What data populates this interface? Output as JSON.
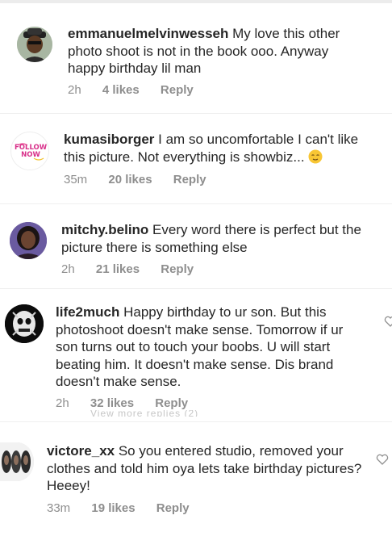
{
  "comments": [
    {
      "username": "emmanuelmelvinwesseh",
      "text": " My love this other photo shoot is not in the book ooo. Anyway happy birthday lil man",
      "time": "2h",
      "likes": "4 likes",
      "reply": "Reply",
      "avatar_icon": "avatar-man-hat"
    },
    {
      "username": "kumasiborger",
      "text": " I am so uncomfortable I can't like this picture. Not everything is showbiz... ",
      "emoji": "relieved-face-emoji",
      "time": "35m",
      "likes": "20 likes",
      "reply": "Reply",
      "avatar_text": "FOLLOW NOW"
    },
    {
      "username": "mitchy.belino",
      "text": " Every word there is perfect but the picture there is something else",
      "time": "2h",
      "likes": "21 likes",
      "reply": "Reply",
      "avatar_icon": "avatar-woman"
    },
    {
      "username": "life2much",
      "text": " Happy birthday to ur son. But this photoshoot doesn't make sense. Tomorrow if ur son turns out to touch your boobs. U will start beating him. It doesn't make sense. Dis brand doesn't make sense.",
      "time": "2h",
      "likes": "32 likes",
      "reply": "Reply",
      "avatar_icon": "avatar-skull-art"
    },
    {
      "username": "victore_xx",
      "text": " So you entered studio, removed your clothes and told him oya lets take birthday pictures? Heeey!",
      "time": "33m",
      "likes": "19 likes",
      "reply": "Reply",
      "avatar_icon": "avatar-faces-collage"
    }
  ],
  "hidden_replies": "View more replies (2)",
  "colors": {
    "text": "#262626",
    "meta": "#8e8e8e",
    "divider": "#efefef"
  }
}
